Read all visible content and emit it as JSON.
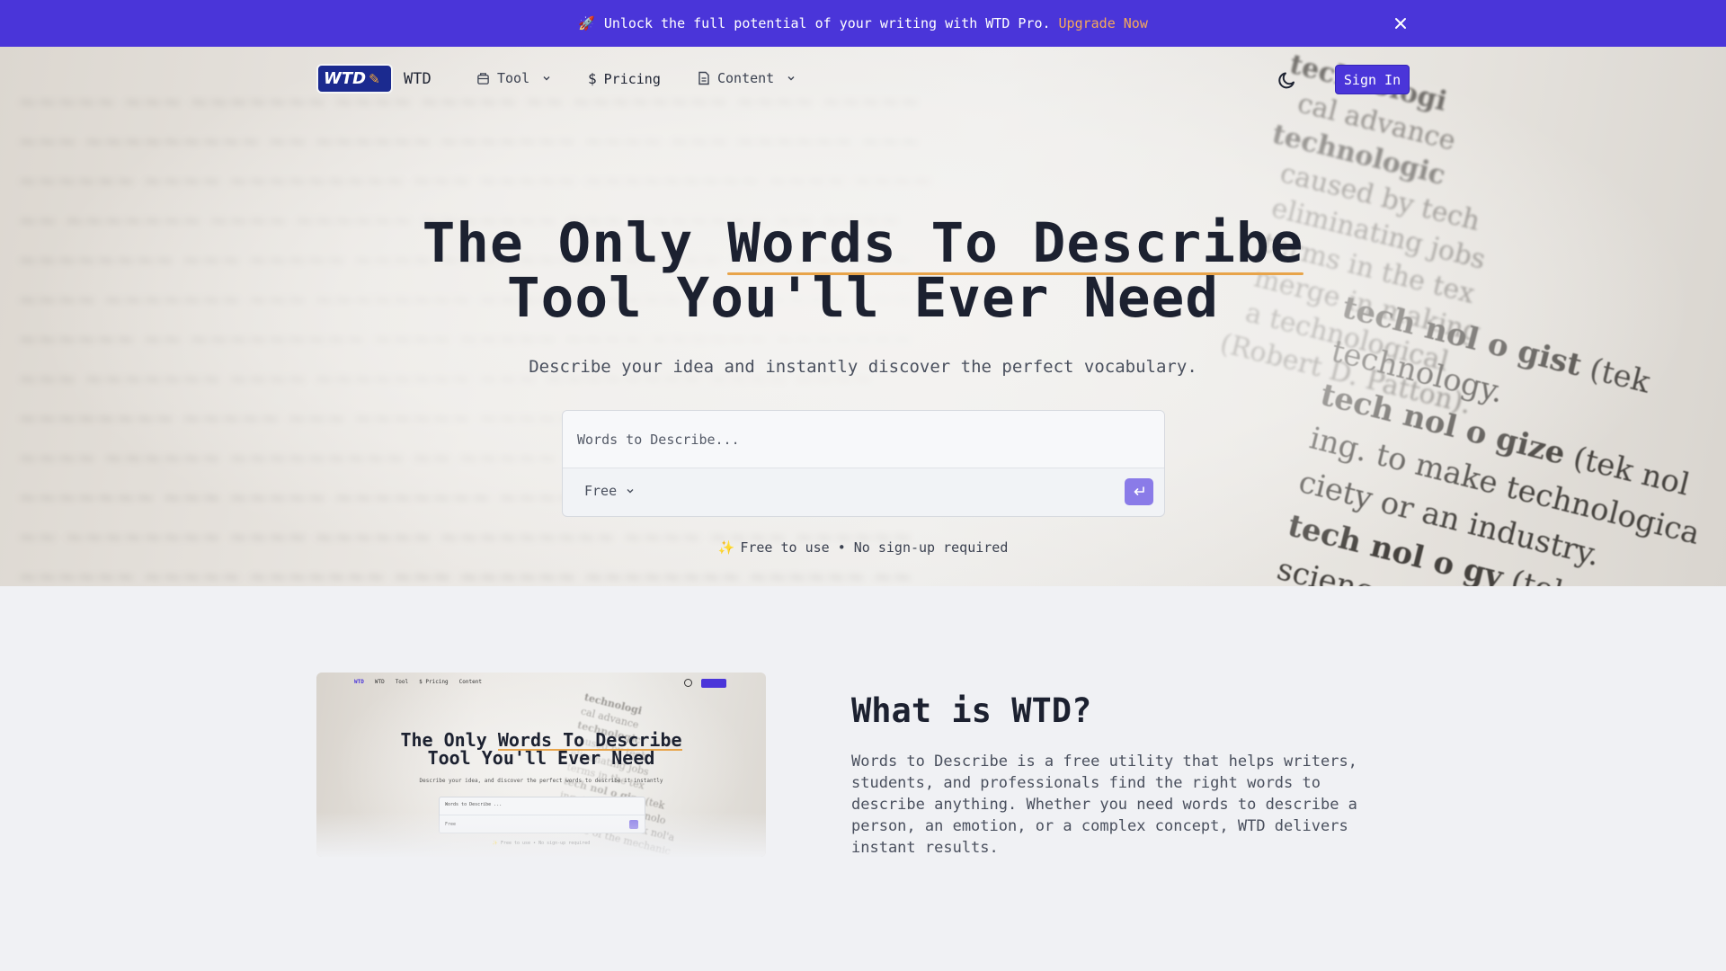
{
  "promo": {
    "icon": "rocket-icon",
    "text": "Unlock the full potential of your writing with WTD Pro.",
    "link": "Upgrade Now"
  },
  "nav": {
    "logo_text": "WTD",
    "brand": "WTD",
    "items": [
      {
        "label": "Tool",
        "icon": "box-icon",
        "dropdown": true
      },
      {
        "label": "Pricing",
        "icon": "dollar-icon",
        "dropdown": false
      },
      {
        "label": "Content",
        "icon": "document-icon",
        "dropdown": true
      }
    ],
    "theme_toggle_icon": "moon-icon",
    "signin": "Sign In"
  },
  "hero": {
    "headline_part1": "The Only",
    "headline_highlight": "Words To Describe",
    "headline_part2": "Tool You'll Ever Need",
    "subtitle": "Describe your idea and instantly discover the perfect vocabulary.",
    "search_placeholder": "Words to Describe...",
    "mode_selected": "Free",
    "note": "Free to use • No sign-up required"
  },
  "about": {
    "title": "What is WTD?",
    "body": "Words to Describe is a free utility that helps writers, students, and professionals find the right words to describe anything. Whether you need words to describe a person, an emotion, or a complex concept, WTD delivers instant results."
  },
  "colors": {
    "accent": "#4a35d9",
    "highlight": "#e8a44a",
    "submit": "#8a7be8"
  }
}
